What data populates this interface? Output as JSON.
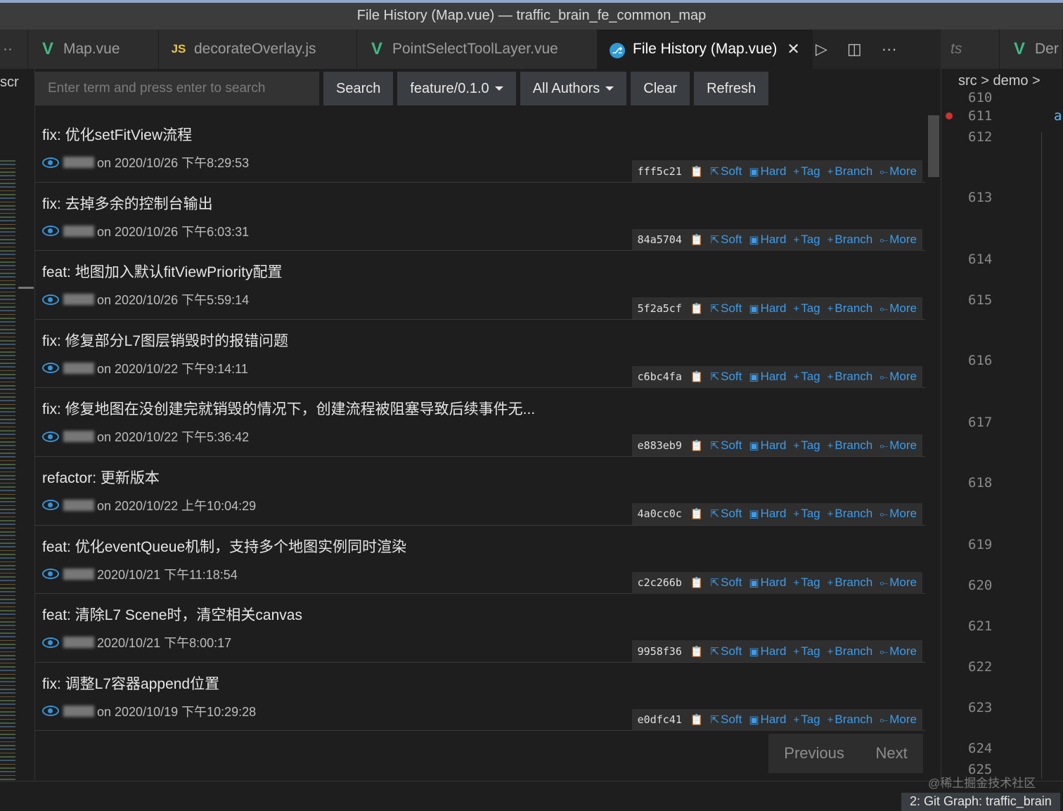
{
  "window": {
    "title": "File History (Map.vue) — traffic_brain_fe_common_map"
  },
  "tabs": [
    {
      "label": "Map.vue",
      "icon": "vue-icon"
    },
    {
      "label": "decorateOverlay.js",
      "icon": "js-icon"
    },
    {
      "label": "PointSelectToolLayer.vue",
      "icon": "vue-icon"
    },
    {
      "label": "File History (Map.vue)",
      "icon": "git-graph-icon"
    },
    {
      "label": "ts",
      "icon": ""
    },
    {
      "label": "Der",
      "icon": "vue-icon"
    }
  ],
  "left": {
    "label": "scr"
  },
  "controls": {
    "search_placeholder": "Enter term and press enter to search",
    "search_label": "Search",
    "branch_label": "feature/0.1.0",
    "authors_label": "All Authors",
    "clear_label": "Clear",
    "refresh_label": "Refresh"
  },
  "action_labels": {
    "soft": "Soft",
    "hard": "Hard",
    "tag": "Tag",
    "branch": "Branch",
    "more": "More"
  },
  "commits": [
    {
      "message": "fix: 优化setFitView流程",
      "date": "on 2020/10/26 下午8:29:53",
      "hash": "fff5c21"
    },
    {
      "message": "fix: 去掉多余的控制台输出",
      "date": "on 2020/10/26 下午6:03:31",
      "hash": "84a5704"
    },
    {
      "message": "feat: 地图加入默认fitViewPriority配置",
      "date": "on 2020/10/26 下午5:59:14",
      "hash": "5f2a5cf"
    },
    {
      "message": "fix: 修复部分L7图层销毁时的报错问题",
      "date": "on 2020/10/22 下午9:14:11",
      "hash": "c6bc4fa"
    },
    {
      "message": "fix: 修复地图在没创建完就销毁的情况下，创建流程被阻塞导致后续事件无...",
      "date": "on 2020/10/22 下午5:36:42",
      "hash": "e883eb9"
    },
    {
      "message": "refactor: 更新版本",
      "date": "on 2020/10/22 上午10:04:29",
      "hash": "4a0cc0c"
    },
    {
      "message": "feat: 优化eventQueue机制，支持多个地图实例同时渲染",
      "date": "2020/10/21 下午11:18:54",
      "hash": "c2c266b"
    },
    {
      "message": "feat: 清除L7 Scene时，清空相关canvas",
      "date": "2020/10/21 下午8:00:17",
      "hash": "9958f36"
    },
    {
      "message": "fix: 调整L7容器append位置",
      "date": "on 2020/10/19 下午10:29:28",
      "hash": "e0dfc41"
    }
  ],
  "pager": {
    "previous": "Previous",
    "next": "Next"
  },
  "editor": {
    "breadcrumb": "src > demo >",
    "lines": [
      "610",
      "611",
      "612",
      "613",
      "614",
      "615",
      "616",
      "617",
      "618",
      "619",
      "620",
      "621",
      "622",
      "623",
      "624",
      "625"
    ],
    "code_first": "asy"
  },
  "status": {
    "git_graph": "2: Git Graph: traffic_brain"
  },
  "watermark": "@稀土掘金技术社区",
  "colors": {
    "accent": "#3d9be9",
    "vue": "#41b883",
    "js": "#e8c547"
  }
}
